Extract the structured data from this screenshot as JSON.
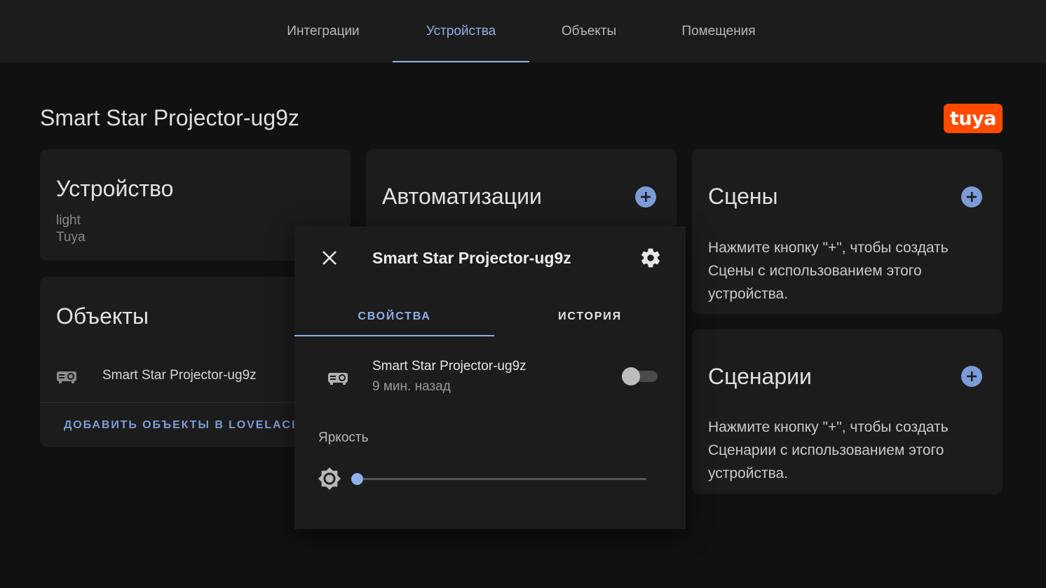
{
  "tabs": [
    {
      "label": "Интеграции",
      "active": false
    },
    {
      "label": "Устройства",
      "active": true
    },
    {
      "label": "Объекты",
      "active": false
    },
    {
      "label": "Помещения",
      "active": false
    }
  ],
  "page_title": "Smart Star Projector-ug9z",
  "brand_logo_text": "tuya",
  "device_card": {
    "title": "Устройство",
    "model": "light",
    "manufacturer": "Tuya"
  },
  "entities_card": {
    "title": "Объекты",
    "entity_name": "Smart Star Projector-ug9z",
    "add_button": "ДОБАВИТЬ ОБЪЕКТЫ В LOVELACE UI"
  },
  "automations_card": {
    "title": "Автоматизации"
  },
  "scenes_card": {
    "title": "Сцены",
    "text": "Нажмите кнопку \"+\", чтобы создать Сцены с использованием этого устройства."
  },
  "scripts_card": {
    "title": "Сценарии",
    "text": "Нажмите кнопку \"+\", чтобы создать Сценарии с использованием этого устройства."
  },
  "dialog": {
    "title": "Smart Star Projector-ug9z",
    "tab_properties": "СВОЙСТВА",
    "tab_history": "ИСТОРИЯ",
    "entity_name": "Smart Star Projector-ug9z",
    "last_changed": "9 мин. назад",
    "toggle_on": false,
    "brightness_label": "Яркость",
    "brightness_value": 0
  },
  "colors": {
    "accent": "#8fb0ea",
    "add_button": "#7b9cd6",
    "background": "#111111",
    "card": "#1c1c1c",
    "tuya_brand": "#ff4a00"
  }
}
